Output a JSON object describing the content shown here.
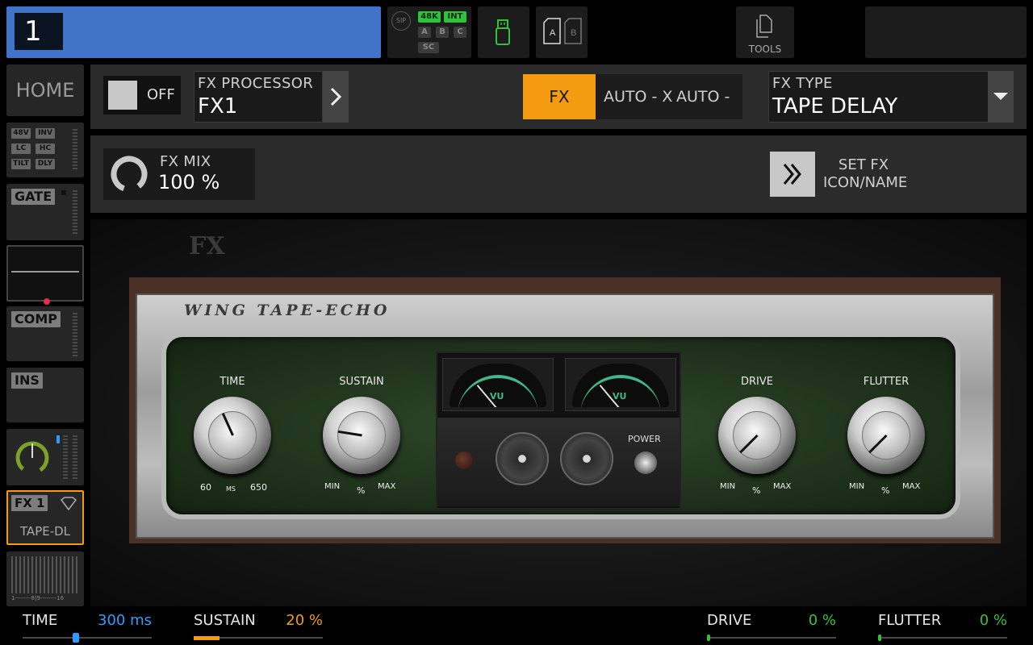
{
  "top_bar": {
    "channel_number": "1",
    "status": {
      "sip": "SIP",
      "rate": "48K",
      "clock": "INT",
      "slots": [
        "A",
        "B",
        "C"
      ],
      "sc": "SC"
    },
    "card_slots": [
      "A",
      "B"
    ],
    "tools_label": "TOOLS"
  },
  "left_strip": {
    "home": "HOME",
    "input_tags": [
      "48V",
      "INV",
      "LC",
      "HC",
      "TILT",
      "DLY"
    ],
    "gate": "GATE",
    "comp": "COMP",
    "ins": "INS",
    "fx_slot": "FX 1",
    "fx_slot_name": "TAPE-DL",
    "meter_scale": "1--------8|9--------16"
  },
  "header": {
    "onoff_label": "OFF",
    "fx_processor_caption": "FX PROCESSOR",
    "fx_processor_value": "FX1",
    "fx_button": "FX",
    "auto_x": "AUTO - X",
    "auto_y": "AUTO - Y",
    "fx_type_caption": "FX TYPE",
    "fx_type_value": "TAPE DELAY",
    "fx_mix_caption": "FX MIX",
    "fx_mix_value": "100 %",
    "set_fx_line1": "SET FX",
    "set_fx_line2": "ICON/NAME"
  },
  "device": {
    "logo": "FX",
    "name": "WING TAPE-ECHO",
    "knobs": [
      {
        "label": "TIME",
        "min": "60",
        "unit": "MS",
        "max": "650",
        "level": 0.41
      },
      {
        "label": "SUSTAIN",
        "min": "MIN",
        "unit": "%",
        "max": "MAX",
        "level": 0.2
      },
      {
        "label": "DRIVE",
        "min": "MIN",
        "unit": "%",
        "max": "MAX",
        "level": 0.0
      },
      {
        "label": "FLUTTER",
        "min": "MIN",
        "unit": "%",
        "max": "MAX",
        "level": 0.0
      }
    ],
    "vu_label": "VU",
    "power_label": "POWER"
  },
  "bottom_params": [
    {
      "name": "TIME",
      "value": "300 ms",
      "level": 0.41,
      "color": "#2f9bff"
    },
    {
      "name": "SUSTAIN",
      "value": "20 %",
      "level": 0.2,
      "color": "#f49b12"
    },
    {
      "name": "DRIVE",
      "value": "0 %",
      "level": 0.0,
      "color": "#2fc43a"
    },
    {
      "name": "FLUTTER",
      "value": "0 %",
      "level": 0.0,
      "color": "#2fc43a"
    }
  ],
  "colors": {
    "accent_blue": "#3f74c8",
    "fx_orange": "#f49b12",
    "status_green": "#2fc43a",
    "fx_slot_border": "#f49b12"
  }
}
